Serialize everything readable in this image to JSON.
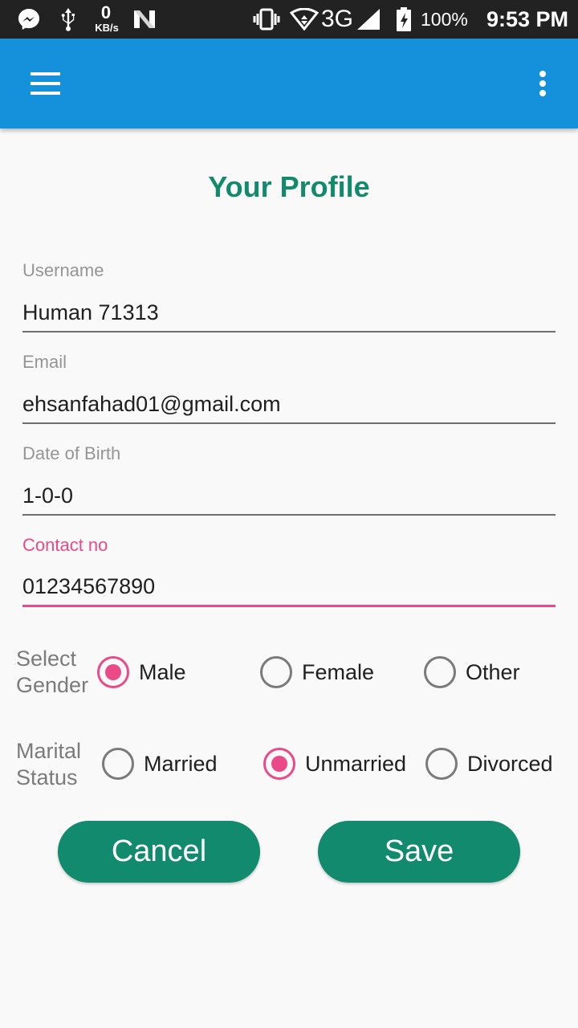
{
  "status_bar": {
    "net_speed_value": "0",
    "net_speed_unit": "KB/s",
    "network_type": "3G",
    "battery": "100%",
    "time": "9:53 PM"
  },
  "app_bar": {
    "menu_icon": "hamburger-menu-icon",
    "overflow_icon": "more-vert-icon",
    "color": "#1591dc"
  },
  "page": {
    "title": "Your Profile"
  },
  "form": {
    "username": {
      "label": "Username",
      "value": "Human 71313"
    },
    "email": {
      "label": "Email",
      "value": "ehsanfahad01@gmail.com"
    },
    "dob": {
      "label": "Date of Birth",
      "value": "1-0-0"
    },
    "contact": {
      "label": "Contact no",
      "value": "01234567890"
    }
  },
  "gender": {
    "label_line1": "Select",
    "label_line2": "Gender",
    "options": [
      "Male",
      "Female",
      "Other"
    ],
    "selected": "Male"
  },
  "marital": {
    "label_line1": "Marital",
    "label_line2": "Status",
    "options": [
      "Married",
      "Unmarried",
      "Divorced"
    ],
    "selected": "Unmarried"
  },
  "actions": {
    "cancel_label": "Cancel",
    "save_label": "Save"
  },
  "colors": {
    "accent": "#ea4a87",
    "primary_green": "#128a6e",
    "title_green": "#138a6c"
  }
}
